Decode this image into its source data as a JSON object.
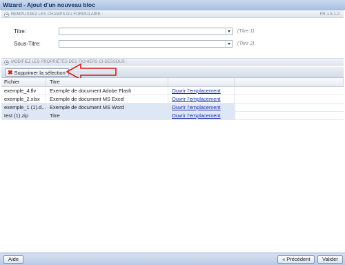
{
  "window": {
    "title": "Wizard - Ajout d'un nouveau bloc"
  },
  "form_section": {
    "heading": "REMPLISSEZ LES CHAMPS DU FORMULAIRE :",
    "version": "FR-1.5.1.2",
    "fields": [
      {
        "label": "Titre:",
        "value": "",
        "hint": "(Titre 1)"
      },
      {
        "label": "Sous-Titre:",
        "value": "",
        "hint": "(Titre 2)"
      }
    ]
  },
  "files_section": {
    "heading": "MODIFIEZ LES PROPRIÉTÉS DES FICHIERS CI-DESSOUS :",
    "delete_button": "Supprimer la sélection",
    "columns": [
      "Fichier",
      "Titre",
      "",
      ""
    ],
    "rows": [
      {
        "file": "exemple_4.flv",
        "title": "Exemple de document Adobe Flash",
        "link": "Ouvrir l'emplacement"
      },
      {
        "file": "exemple_2.xlsx",
        "title": "Exemple de document MS Excel",
        "link": "Ouvrir l'emplacement"
      },
      {
        "file": "exemple_1 (1).d...",
        "title": "Exemple de document MS Word",
        "link": "Ouvrir l'emplacement"
      },
      {
        "file": "test (1).zip",
        "title": "Titre",
        "link": "Ouvrir l'emplacement"
      }
    ]
  },
  "footer": {
    "help": "Aide",
    "previous": "« Précédent",
    "validate": "Valider"
  },
  "colors": {
    "annotation_arrow": "#d21a1a",
    "link": "#1a2fb0",
    "row_highlight": "#dde7f6"
  },
  "icons": {
    "delete": "red-x-icon",
    "collapse": "collapse-up-icon",
    "dropdown": "chevron-down-icon"
  }
}
